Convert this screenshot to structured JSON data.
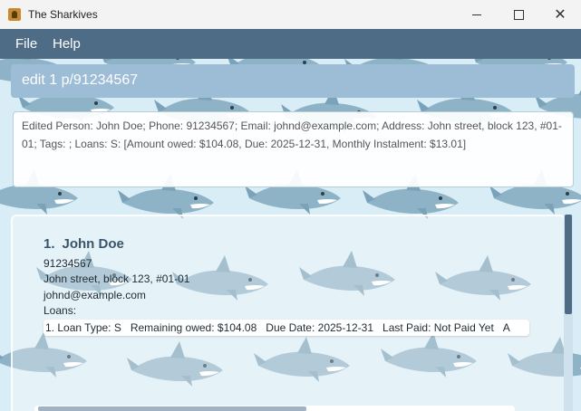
{
  "window": {
    "title": "The Sharkives"
  },
  "menu": {
    "file": "File",
    "help": "Help"
  },
  "command": {
    "value": "edit 1 p/91234567"
  },
  "result": {
    "text": "Edited Person: John Doe; Phone: 91234567; Email: johnd@example.com; Address: John street, block 123, #01-01; Tags: ; Loans: S: [Amount owed: $104.08, Due: 2025-12-31, Monthly Instalment: $13.01]"
  },
  "persons": [
    {
      "index": "1.",
      "name": "John Doe",
      "phone": "91234567",
      "address": "John street, block 123, #01-01",
      "email": "johnd@example.com",
      "loans_label": "Loans:",
      "loans": [
        {
          "index_type": "1. Loan Type: S",
          "remaining": "Remaining owed: $104.08",
          "due": "Due Date: 2025-12-31",
          "last_paid": "Last Paid: Not Paid Yet",
          "more": "A"
        }
      ]
    }
  ],
  "colors": {
    "menubar": "#4f6c87",
    "command_box": "#9dbcd6",
    "background": "#d9edf6",
    "name": "#3b546a"
  },
  "icons": {
    "app": "shark-chest-icon",
    "background": "shark-wallpaper"
  }
}
